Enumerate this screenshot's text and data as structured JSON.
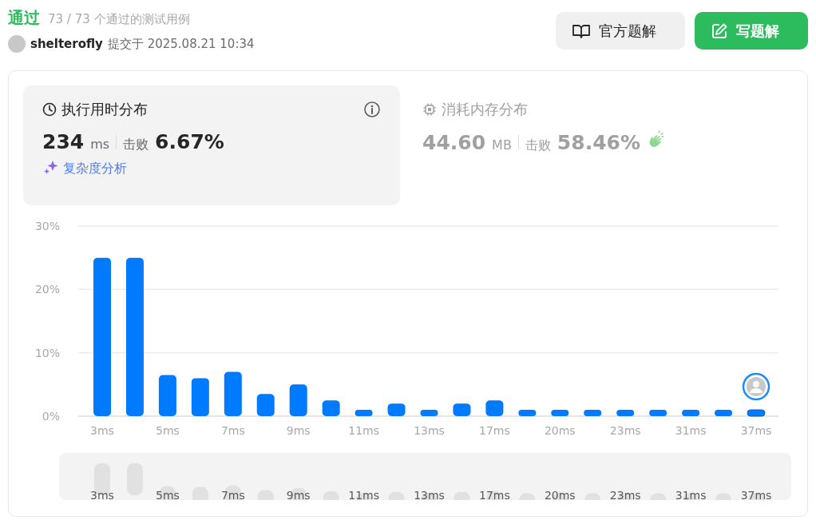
{
  "header": {
    "status": "通过",
    "cases": "73 / 73 个通过的测试用例",
    "user": "shelterofly",
    "submitted": "提交于 2025.08.21 10:34"
  },
  "buttons": [
    {
      "label": "官方题解",
      "kind": "secondary"
    },
    {
      "label": "写题解",
      "kind": "primary"
    }
  ],
  "metrics": [
    {
      "kind": "runtime",
      "title": "执行用时分布",
      "selected": true,
      "value": "234",
      "unit": "ms",
      "beats_label": "击败",
      "beats": "6.67%",
      "link": "复杂度分析"
    },
    {
      "kind": "memory",
      "title": "消耗内存分布",
      "selected": false,
      "value": "44.60",
      "unit": "MB",
      "beats_label": "击败",
      "beats": "58.46%"
    }
  ],
  "chart": {
    "bars": [
      {
        "selected": false
      },
      {
        "selected": false
      },
      {
        "selected": false
      },
      {
        "selected": false
      },
      {
        "selected": false
      },
      {
        "selected": false
      },
      {
        "selected": false
      },
      {
        "selected": false
      },
      {
        "selected": false
      },
      {
        "selected": false
      },
      {
        "selected": false
      },
      {
        "selected": false
      },
      {
        "selected": false
      },
      {
        "selected": false
      },
      {
        "selected": false
      },
      {
        "selected": false
      },
      {
        "selected": false
      },
      {
        "selected": false
      },
      {
        "selected": false
      },
      {
        "selected": false
      },
      {
        "selected": true
      }
    ],
    "chart_data": {
      "type": "bar",
      "categories": [
        "3ms",
        null,
        "5ms",
        null,
        "7ms",
        null,
        "9ms",
        null,
        "11ms",
        null,
        "13ms",
        null,
        "17ms",
        null,
        "20ms",
        null,
        "23ms",
        null,
        "31ms",
        null,
        "37ms"
      ],
      "series": [
        {
          "color": "#007aff",
          "values": [
            25,
            25,
            6.5,
            6,
            7,
            3.5,
            5,
            2.5,
            1,
            2,
            1,
            2,
            2.5,
            1,
            1,
            1,
            1,
            1,
            1,
            1,
            1
          ]
        }
      ],
      "ylim": [
        0,
        30
      ],
      "yticks": [
        {
          "value": 0,
          "label": "0%"
        },
        {
          "value": 10,
          "label": "10%"
        },
        {
          "value": 20,
          "label": "20%"
        },
        {
          "value": 30,
          "label": "30%"
        }
      ]
    },
    "overview_labels": [
      "3ms",
      "5ms",
      "7ms",
      "9ms",
      "11ms",
      "13ms",
      "17ms",
      "20ms",
      "23ms",
      "31ms",
      "37ms"
    ]
  }
}
